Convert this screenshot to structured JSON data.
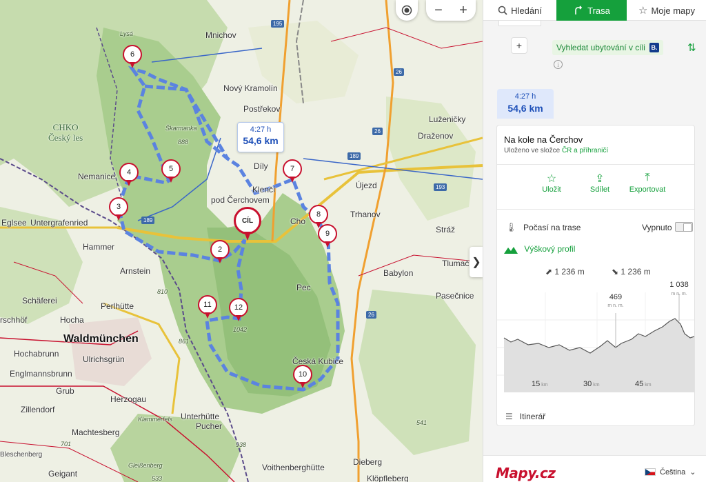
{
  "map": {
    "route_bubble": {
      "time": "4:27 h",
      "distance": "54,6 km"
    },
    "markers": [
      {
        "label": "6"
      },
      {
        "label": "5"
      },
      {
        "label": "4"
      },
      {
        "label": "3"
      },
      {
        "label": "7"
      },
      {
        "label": "8"
      },
      {
        "label": "9"
      },
      {
        "label": "2"
      },
      {
        "label": "11"
      },
      {
        "label": "12"
      },
      {
        "label": "10"
      },
      {
        "label": "CÍL"
      }
    ],
    "places": {
      "mnichov": "Mnichov",
      "novy_kramolin": "Nový Kramolín",
      "postrekov": "Postřekov",
      "luzenicky": "Luženičky",
      "drazenov": "Draženov",
      "dily": "Díly",
      "klenci": "Klenčí",
      "pod_cerchovem": "pod Čerchovem",
      "ujezd": "Újezd",
      "trhanov": "Trhanov",
      "chodov": "Cho",
      "straz": "Stráž",
      "tlumacov": "Tlumač",
      "babylon": "Babylon",
      "pec": "Pec",
      "pasecnice": "Pasečnice",
      "ceska_kubice": "Česká Kubice",
      "nemanice": "Nemanice",
      "eglsee": "Eglsee",
      "untergrafenried": "Untergrafenried",
      "hammer": "Hammer",
      "arnstein": "Arnstein",
      "schaferei": "Schäferei",
      "perlhutte": "Perlhütte",
      "hocha": "Hocha",
      "rschhof": "rschhöf",
      "waldmunchen": "Waldmünchen",
      "hochabrunn": "Hochabrunn",
      "ulrichsgrun": "Ulrichsgrün",
      "englmannsbrunn": "Englmannsbrunn",
      "grub": "Grub",
      "herzogau": "Herzogau",
      "zillendorf": "Zillendorf",
      "machtesberg": "Machtesberg",
      "unterhutte": "Unterhütte",
      "pucher": "Pucher",
      "klammerfels": "Klammerfels",
      "bleschenberg": "Bleschenberg",
      "gleissenberg": "Gleißenberg",
      "geigant": "Geigant",
      "voithenberghutte": "Voithenberghütte",
      "dieberg": "Dieberg",
      "klopfleberg": "Klöpfleberg",
      "lysa": "Lysá",
      "skarmanka": "Škarmanka",
      "chko": "CHKO",
      "cesky_les": "Český les"
    },
    "peaks": {
      "p888": "888",
      "p810": "810",
      "p861": "861",
      "p1042": "1042",
      "p938": "938",
      "p533": "533",
      "p701": "701",
      "p541": "541"
    },
    "road_numbers": {
      "r195": "195",
      "r26a": "26",
      "r189a": "189",
      "r189b": "189",
      "r193": "193",
      "r26b": "26",
      "r26c": "26"
    },
    "controls": {
      "locate_icon": "target-icon",
      "zoom_out": "−",
      "zoom_in": "+",
      "collapse": "❯"
    }
  },
  "panel": {
    "tabs": [
      {
        "label": "Hledání",
        "icon": "search-icon"
      },
      {
        "label": "Trasa",
        "icon": "route-icon",
        "active": true
      },
      {
        "label": "Moje mapy",
        "icon": "star-icon"
      }
    ],
    "add_point_label": "+",
    "accommodation_link": "Vyhledat ubytování v cíli",
    "booking_badge": "B.",
    "route_summary": {
      "time": "4:27 h",
      "distance": "54,6 km"
    },
    "card": {
      "title": "Na kole na Čerchov",
      "subtitle_prefix": "Uloženo ve složce ",
      "folder": "ČR a příhraničí",
      "actions": [
        {
          "label": "Uložit",
          "icon": "star-icon"
        },
        {
          "label": "Sdílet",
          "icon": "share-icon"
        },
        {
          "label": "Exportovat",
          "icon": "export-icon"
        }
      ],
      "weather_label": "Počasí na trase",
      "weather_state": "Vypnuto",
      "profile_label": "Výškový profil",
      "ascent": "1 236 m",
      "descent": "1 236 m",
      "profile": {
        "min_label": "469",
        "max_label": "1 038",
        "unit_label": "m n. m.",
        "x_ticks": [
          {
            "value": "15",
            "unit": "km"
          },
          {
            "value": "30",
            "unit": "km"
          },
          {
            "value": "45",
            "unit": "km"
          }
        ]
      },
      "itinerary_label": "Itinerář"
    },
    "footer": {
      "logo": "Mapy.cz",
      "language": "Čeština"
    }
  },
  "colors": {
    "accent": "#15a03c",
    "route": "#5b83e0",
    "marker": "#c8102e"
  }
}
